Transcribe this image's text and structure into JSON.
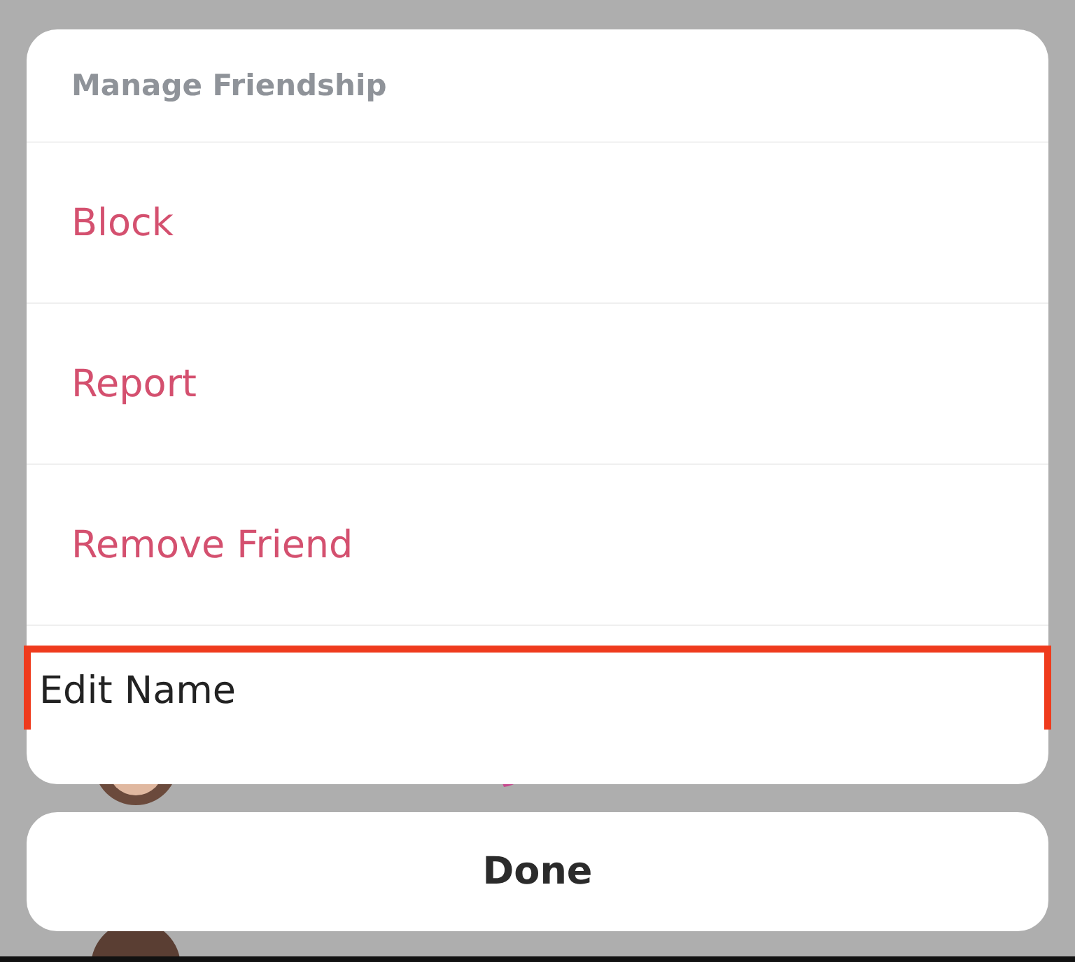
{
  "sheet": {
    "title": "Manage Friendship",
    "items": [
      {
        "label": "Block",
        "kind": "destructive",
        "highlighted": false
      },
      {
        "label": "Report",
        "kind": "destructive",
        "highlighted": false
      },
      {
        "label": "Remove Friend",
        "kind": "destructive",
        "highlighted": false
      },
      {
        "label": "Edit Name",
        "kind": "normal",
        "highlighted": true
      }
    ]
  },
  "done_button": "Done"
}
